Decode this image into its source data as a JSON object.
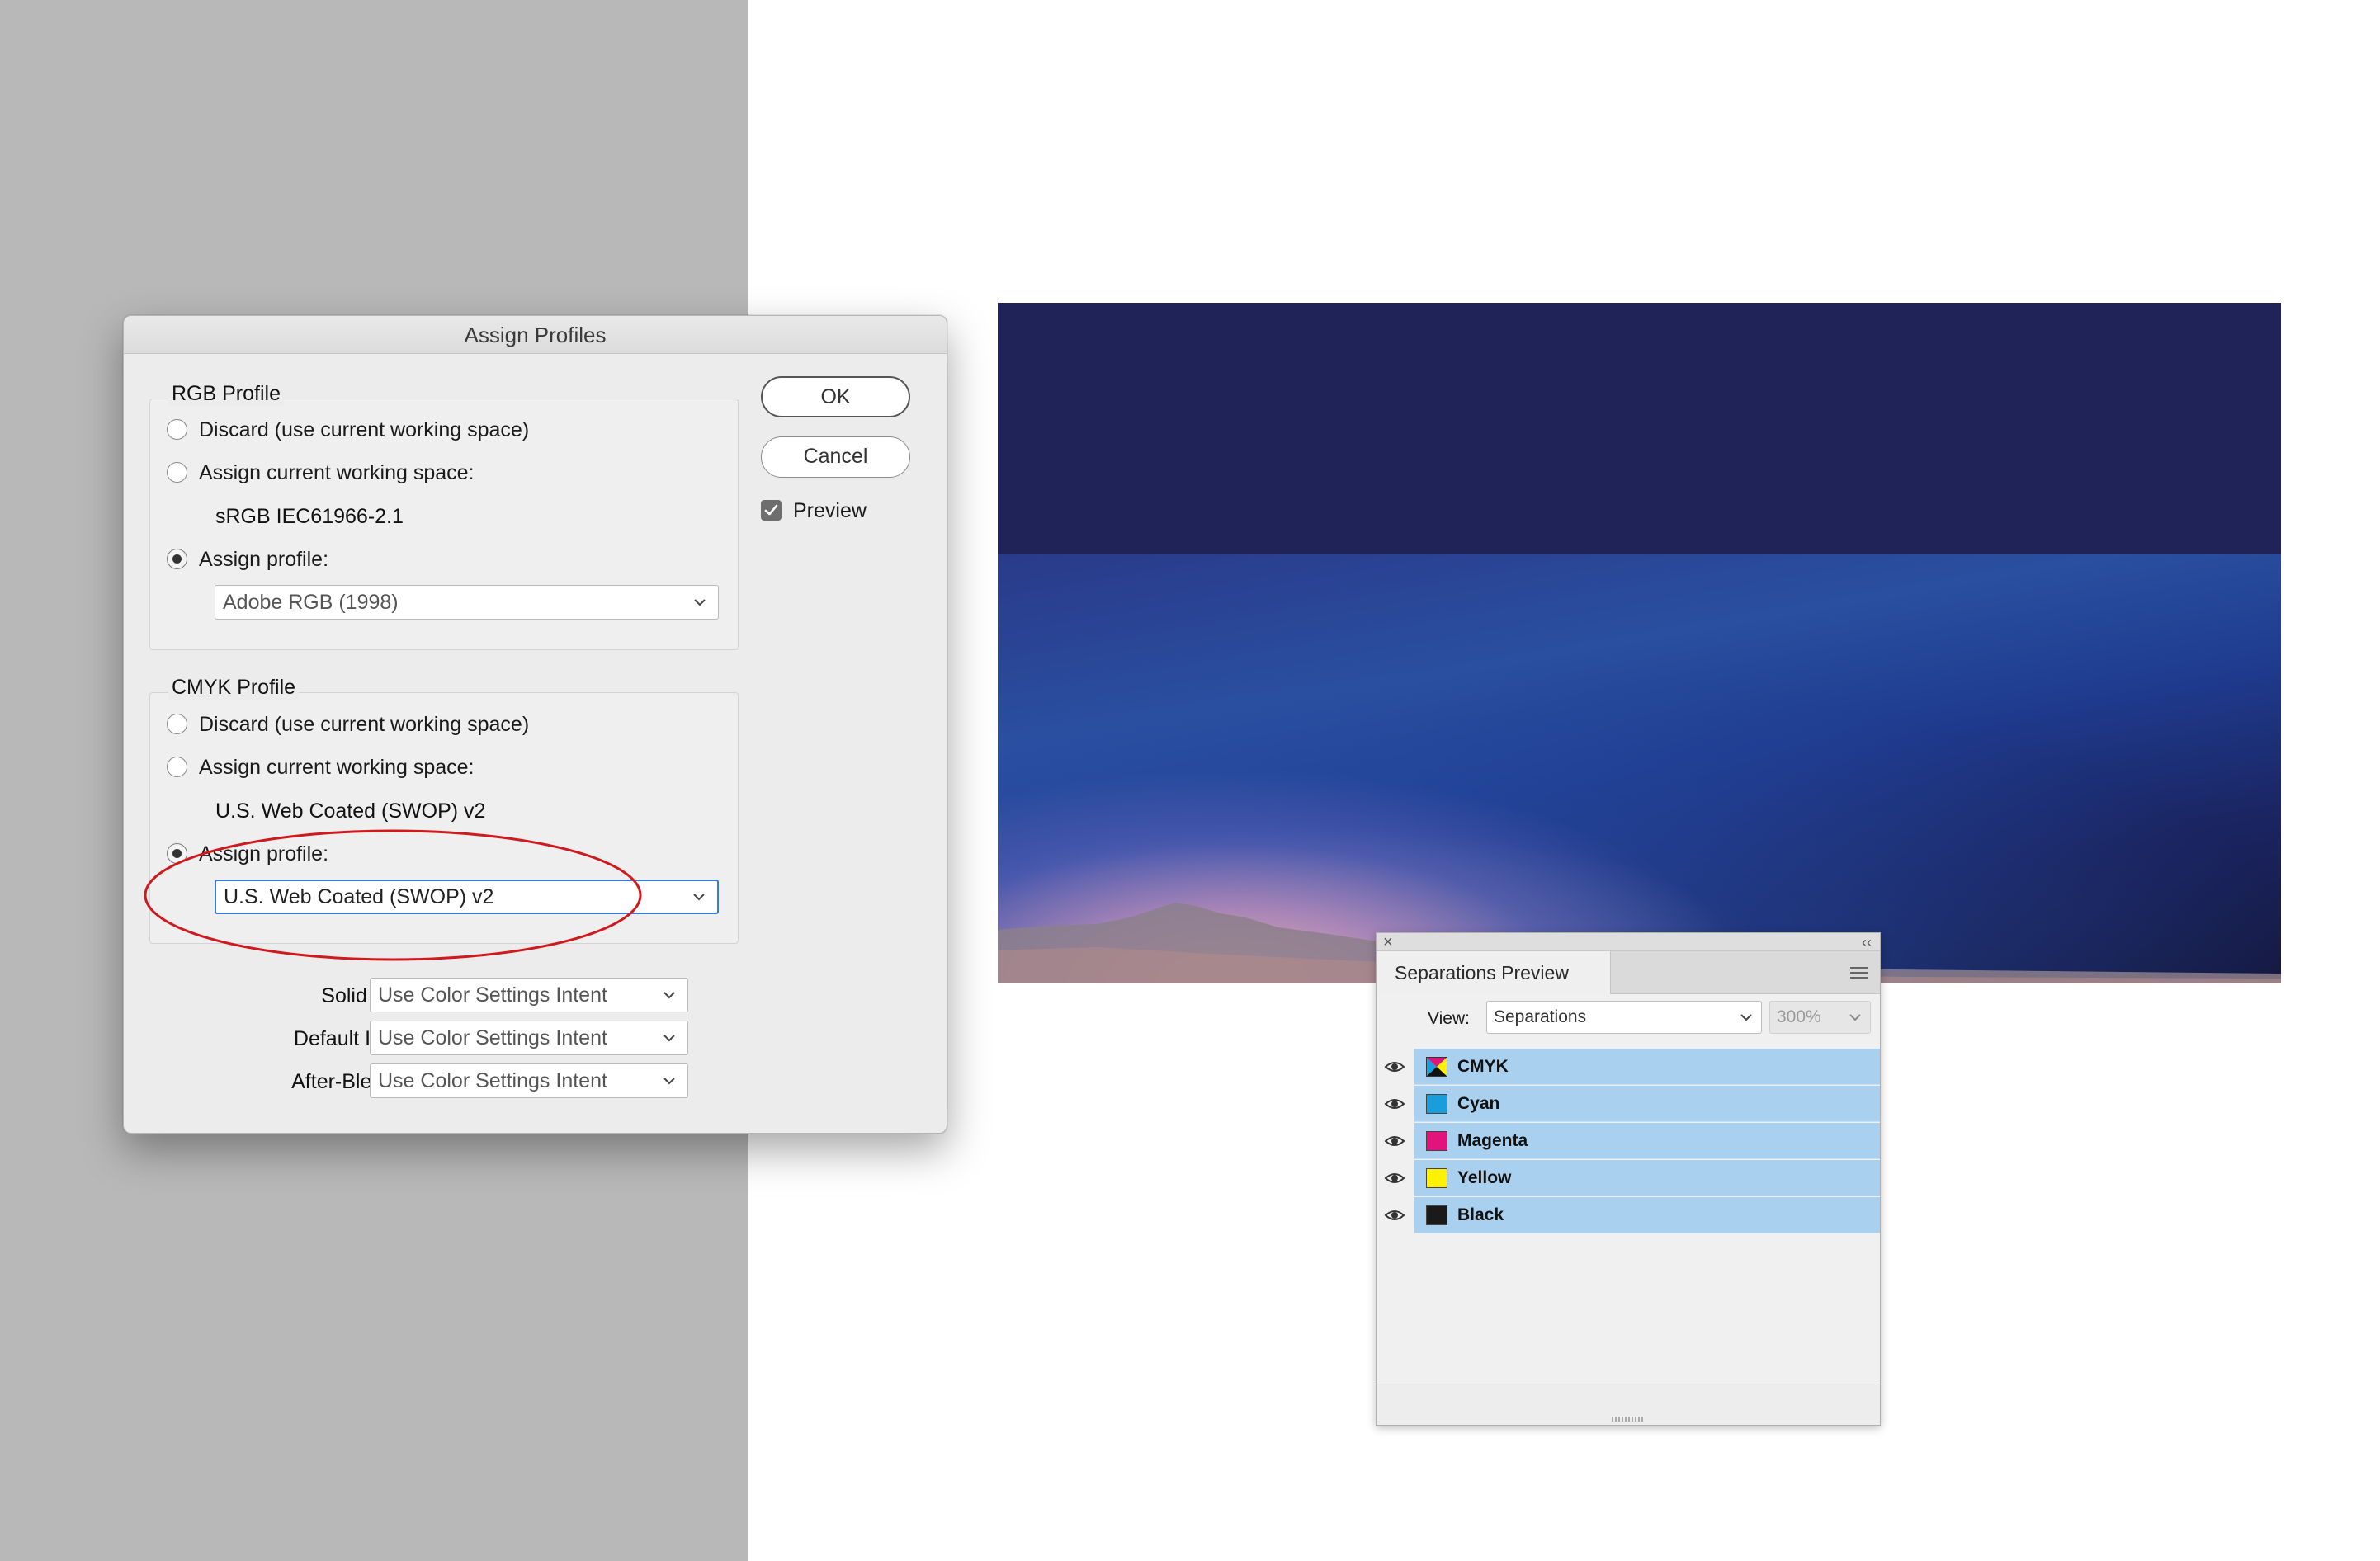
{
  "dialog": {
    "title": "Assign Profiles",
    "rgb": {
      "legend": "RGB Profile",
      "option_discard": "Discard (use current working space)",
      "option_assign_current": "Assign current working space:",
      "current_space": "sRGB IEC61966-2.1",
      "option_assign_profile": "Assign profile:",
      "profile_value": "Adobe RGB (1998)"
    },
    "cmyk": {
      "legend": "CMYK Profile",
      "option_discard": "Discard (use current working space)",
      "option_assign_current": "Assign current working space:",
      "current_space": "U.S. Web Coated (SWOP) v2",
      "option_assign_profile": "Assign profile:",
      "profile_value": "U.S. Web Coated (SWOP) v2"
    },
    "intents": [
      {
        "label": "Solid Color Intent:",
        "value": "Use Color Settings Intent"
      },
      {
        "label": "Default Image Intent:",
        "value": "Use Color Settings Intent"
      },
      {
        "label": "After-Blending Intent:",
        "value": "Use Color Settings Intent"
      }
    ],
    "buttons": {
      "ok": "OK",
      "cancel": "Cancel"
    },
    "preview_label": "Preview",
    "preview_checked": true,
    "annotation_color": "#d0191c"
  },
  "separations": {
    "tab_title": "Separations Preview",
    "view_label": "View:",
    "view_value": "Separations",
    "zoom_value": "300%",
    "inks": [
      {
        "name": "CMYK",
        "icon": "cmyk-swatch-icon",
        "color": "#000000"
      },
      {
        "name": "Cyan",
        "icon": "cyan-swatch-icon",
        "color": "#1a9ddb"
      },
      {
        "name": "Magenta",
        "icon": "magenta-swatch-icon",
        "color": "#e0147a"
      },
      {
        "name": "Yellow",
        "icon": "yellow-swatch-icon",
        "color": "#fff200"
      },
      {
        "name": "Black",
        "icon": "black-swatch-icon",
        "color": "#1a1a1a"
      }
    ],
    "row_highlight_color": "#a9d0ef"
  },
  "colors": {
    "pasteboard": "#b8b8b8",
    "sky_dark": "#1f2358"
  }
}
